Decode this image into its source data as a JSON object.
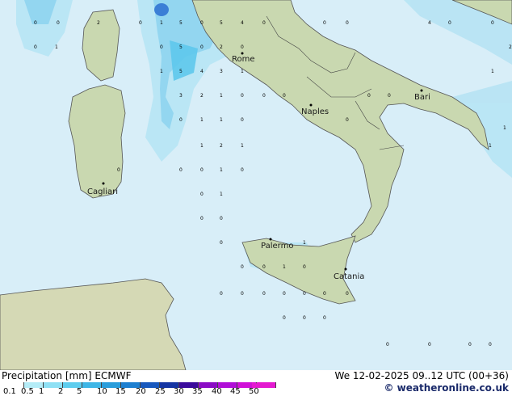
{
  "map": {
    "cities": [
      {
        "name": "Rome"
      },
      {
        "name": "Bari"
      },
      {
        "name": "Naples"
      },
      {
        "name": "Cagliari"
      },
      {
        "name": "Palermo"
      },
      {
        "name": "Catania"
      }
    ]
  },
  "legend": {
    "title": "Precipitation [mm]",
    "model": "ECMWF",
    "date": "We 12-02-2025 09..12 UTC (00+36)",
    "credit": "© weatheronline.co.uk",
    "ticks": [
      "0.1",
      "0.5",
      "1",
      "2",
      "5",
      "10",
      "15",
      "20",
      "25",
      "30",
      "35",
      "40",
      "45",
      "50"
    ],
    "colors": [
      "#ffffff",
      "#b4ecf7",
      "#8ee0f4",
      "#5ecdee",
      "#3fb6e6",
      "#2a9ddb",
      "#1e7fd0",
      "#1858bd",
      "#1535a3",
      "#3a0a9c",
      "#8a0cc5",
      "#b00ed8",
      "#d010d8",
      "#e419d0"
    ]
  }
}
